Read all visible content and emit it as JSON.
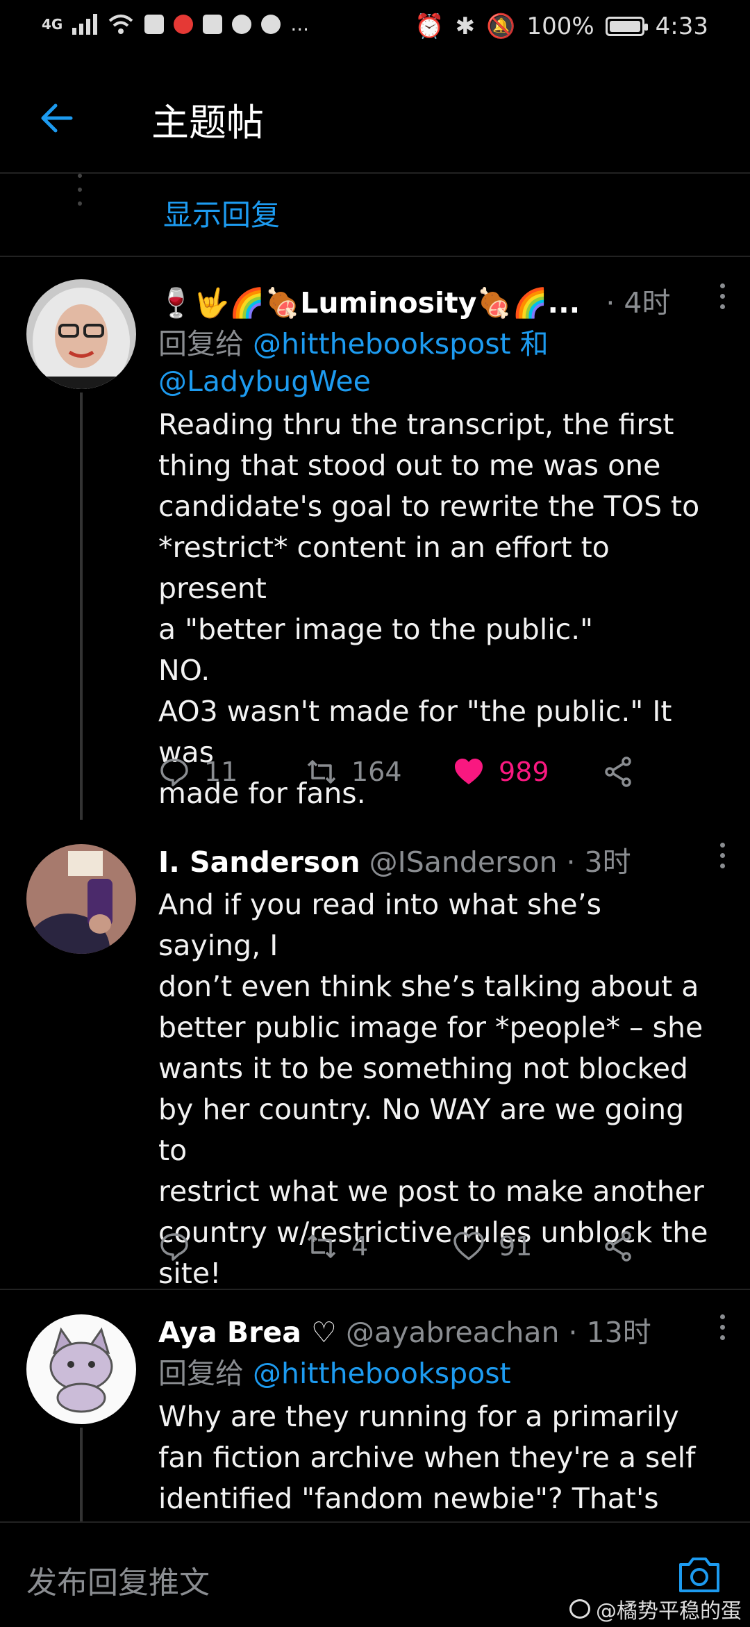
{
  "status_bar": {
    "network": "4G",
    "battery_text": "100%",
    "battery_level": 1.0,
    "time": "4:33",
    "more": "..."
  },
  "header": {
    "title": "主题帖"
  },
  "thread": {
    "show_replies": "显示回复"
  },
  "tweets": [
    {
      "name": "🍷🤟🌈🍖Luminosity🍖🌈...",
      "handle": "",
      "time": "· 4时",
      "reply_prefix": "回复给",
      "mention1": "@hitthebookspost",
      "reply_and": "和",
      "mention2": "@LadybugWee",
      "text": "Reading thru the transcript, the first\nthing that stood out to me was one\ncandidate's goal to rewrite the TOS to\n*restrict* content in an effort to present\na \"better image to the public.\"\nNO.\nAO3 wasn't made for \"the public.\" It was\nmade for fans.",
      "replies": "11",
      "retweets": "164",
      "likes": "989",
      "liked": true
    },
    {
      "name": "I. Sanderson",
      "handle": "@ISanderson",
      "time": "· 3时",
      "text": "And if you read into what she’s saying, I\ndon’t even think she’s talking about a\nbetter public image for *people* – she\nwants it to be something not blocked\nby her country. No WAY are we going to\nrestrict what we post to make another\ncountry w/restrictive rules unblock the\nsite!",
      "replies": "",
      "retweets": "4",
      "likes": "91",
      "liked": false
    },
    {
      "name": "Aya Brea ♡",
      "handle": "@ayabreachan",
      "time": "· 13时",
      "reply_prefix": "回复给",
      "mention1": "@hitthebookspost",
      "text": "Why are they running for a primarily\nfan fiction  archive when they're a self\nidentified \"fandom newbie\"? That's like,"
    }
  ],
  "composer": {
    "placeholder": "发布回复推文"
  },
  "watermark": "@橘势平稳的蛋",
  "colors": {
    "accent": "#1d9bf0",
    "like": "#f91880",
    "muted": "#8a8d91",
    "background": "#000000"
  }
}
